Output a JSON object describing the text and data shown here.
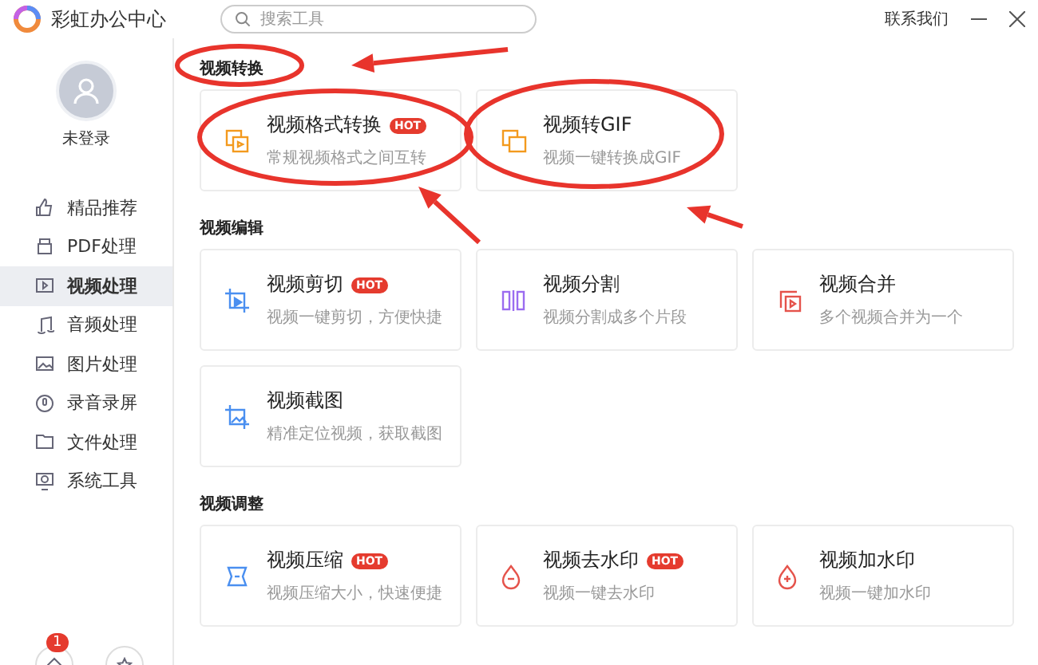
{
  "app": {
    "title": "彩虹办公中心",
    "search": {
      "placeholder": "搜索工具"
    },
    "contact": "联系我们"
  },
  "user": {
    "name": "未登录"
  },
  "sidebar": {
    "items": [
      {
        "label": "精品推荐",
        "selected": false
      },
      {
        "label": "PDF处理",
        "selected": false
      },
      {
        "label": "视频处理",
        "selected": true
      },
      {
        "label": "音频处理",
        "selected": false
      },
      {
        "label": "图片处理",
        "selected": false
      },
      {
        "label": "录音录屏",
        "selected": false
      },
      {
        "label": "文件处理",
        "selected": false
      },
      {
        "label": "系统工具",
        "selected": false
      }
    ],
    "notification_badge": "1"
  },
  "sections": [
    {
      "title": "视频转换",
      "tools": [
        {
          "name": "视频格式转换",
          "badge": "HOT",
          "description": "常规视频格式之间互转"
        },
        {
          "name": "视频转GIF",
          "description": "视频一键转换成GIF"
        }
      ]
    },
    {
      "title": "视频编辑",
      "tools": [
        {
          "name": "视频剪切",
          "badge": "HOT",
          "description": "视频一键剪切，方便快捷"
        },
        {
          "name": "视频分割",
          "description": "视频分割成多个片段"
        },
        {
          "name": "视频合并",
          "description": "多个视频合并为一个"
        },
        {
          "name": "视频截图",
          "description": "精准定位视频，获取截图"
        }
      ]
    },
    {
      "title": "视频调整",
      "tools": [
        {
          "name": "视频压缩",
          "badge": "HOT",
          "description": "视频压缩大小，快速便捷"
        },
        {
          "name": "视频去水印",
          "badge": "HOT",
          "description": "视频一键去水印"
        },
        {
          "name": "视频加水印",
          "description": "视频一键加水印"
        }
      ]
    }
  ]
}
